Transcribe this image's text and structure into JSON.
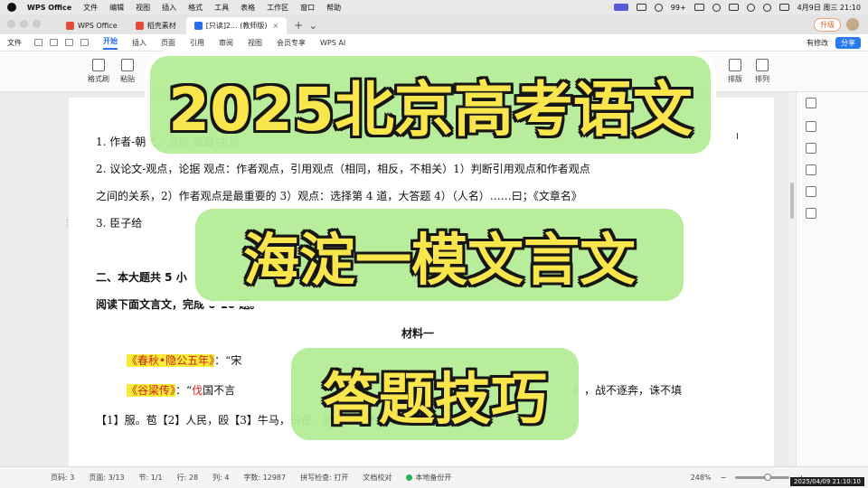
{
  "menubar": {
    "app": "WPS Office",
    "items": [
      "文件",
      "编辑",
      "视图",
      "插入",
      "格式",
      "工具",
      "表格",
      "工作区",
      "窗口",
      "帮助"
    ],
    "badge": "99+",
    "datetime": "4月9日 周三 21:10"
  },
  "tabs": [
    {
      "label": "WPS Office",
      "color": "#e54b3a"
    },
    {
      "label": "稻壳素材",
      "color": "#e54b3a"
    },
    {
      "label": "[只读]2... (教师版)",
      "color": "#2a6ef0",
      "active": true
    }
  ],
  "tabbar": {
    "upgrade": "升级"
  },
  "ribbon": {
    "file": "文件",
    "tabs": [
      "开始",
      "插入",
      "页面",
      "引用",
      "审阅",
      "视图",
      "会员专享"
    ],
    "active": "开始",
    "ai": "WPS AI",
    "share_status": "有修改",
    "share": "分享"
  },
  "toolbar": {
    "format_painter": "格式刷",
    "paste": "粘贴",
    "layout": "排版",
    "arrange": "排列"
  },
  "doc": {
    "line1": "1.  作者-朝代，立场 题目-主旨",
    "line2": "2.   议论文-观点，论据 观点：作者观点，引用观点（相同，相反，不相关）1）判断引用观点和作者观点",
    "line3": "之间的关系，2）作者观点是最重要的 3）观点：选择第 4 道，大答题 4）（人名）……曰；《文章名》",
    "line4": "3.  臣子给",
    "line5": "二、本大题共 5 小",
    "line6": "阅读下面文言文，完成 6-10 题。",
    "heading": "材料一",
    "q1_book": "《春秋•隐公五年》",
    "q1_rest": "：“宋",
    "q2_book": "《谷梁传》",
    "q2_colon": "：“",
    "q2_red": "伐",
    "q2_text": "国不言",
    "q2_tail": "时，战不逐奔，诛不填",
    "line9": "【1】服。苞【2】人民，殴【3】牛马，曰侵。斩树木，坏宫室，曰伐。”"
  },
  "status": {
    "page_code": "页码: 3",
    "page": "页面: 3/13",
    "section": "节: 1/1",
    "row": "行: 28",
    "col": "列: 4",
    "words": "字数: 12987",
    "spell": "拼写检查: 打开",
    "proof": "文档校对",
    "backup": "本地备份开",
    "zoom": "248%",
    "timestamp": "2025/04/09 21:10:10"
  },
  "overlay": {
    "title1": "2025北京高考语文",
    "title2": "海淀一模文言文",
    "title3": "答题技巧",
    "fill_color": "#f8e64c",
    "bg_color": "#b4ec96"
  }
}
